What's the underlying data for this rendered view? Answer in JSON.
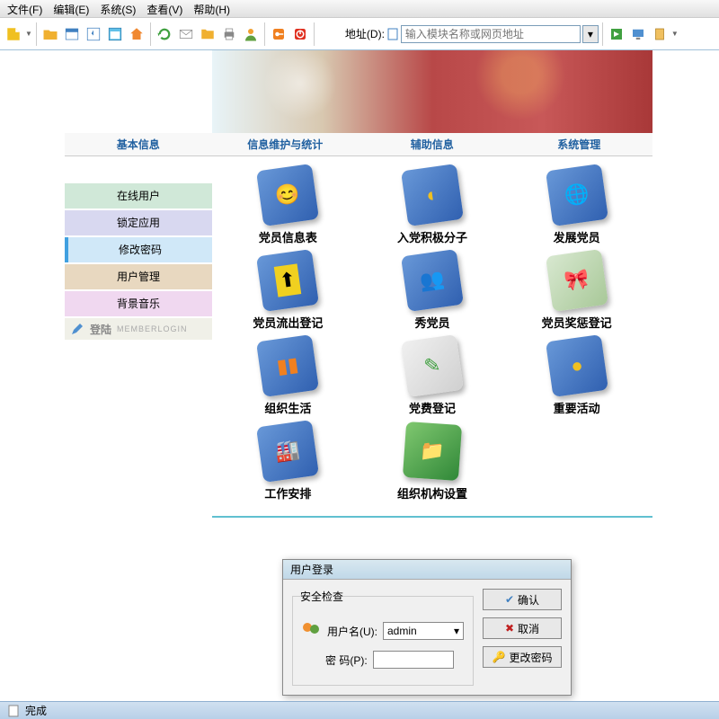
{
  "menu": {
    "file": "文件(F)",
    "edit": "编辑(E)",
    "system": "系统(S)",
    "view": "查看(V)",
    "help": "帮助(H)"
  },
  "address": {
    "label": "地址(D):",
    "placeholder": "输入模块名称或网页地址"
  },
  "tabs": {
    "a": "基本信息",
    "b": "信息维护与统计",
    "c": "辅助信息",
    "d": "系统管理"
  },
  "sidebar": {
    "items": [
      {
        "label": "在线用户"
      },
      {
        "label": "锁定应用"
      },
      {
        "label": "修改密码"
      },
      {
        "label": "用户管理"
      },
      {
        "label": "背景音乐"
      }
    ],
    "login": "登陆",
    "login_sub": "MEMBERLOGIN"
  },
  "grid": {
    "c0": "党员信息表",
    "c1": "入党积极分子",
    "c2": "发展党员",
    "c3": "党员流出登记",
    "c4": "秀党员",
    "c5": "党员奖惩登记",
    "c6": "组织生活",
    "c7": "党费登记",
    "c8": "重要活动",
    "c9": "工作安排",
    "c10": "组织机构设置"
  },
  "dialog": {
    "title": "用户登录",
    "group": "安全检查",
    "username_label": "用户名(U):",
    "username_value": "admin",
    "password_label": "密  码(P):",
    "ok": "确认",
    "cancel": "取消",
    "changepw": "更改密码"
  },
  "status": {
    "done": "完成"
  }
}
